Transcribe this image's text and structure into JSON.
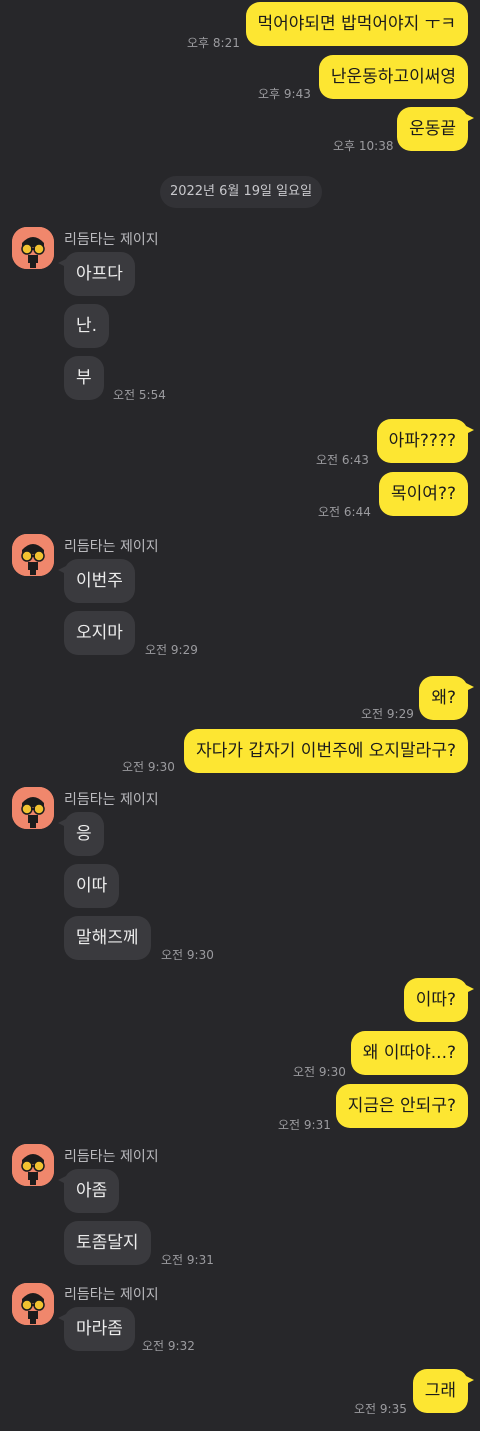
{
  "date_divider": "2022년 6월 19일 일요일",
  "sender_name": "리듬타는 제이지",
  "messages": {
    "m1": {
      "text": "먹어야되면 밥먹어야지 ㅜㅋ",
      "time": "오후 8:21"
    },
    "m2": {
      "text": "난운동하고이써영",
      "time": "오후 9:43"
    },
    "m3": {
      "text": "운동끝",
      "time": "오후 10:38"
    },
    "t1": {
      "text": "아프다"
    },
    "t2": {
      "text": "난."
    },
    "t3": {
      "text": "부",
      "time": "오전 5:54"
    },
    "m4": {
      "text": "아파????",
      "time": "오전 6:43"
    },
    "m5": {
      "text": "목이여??",
      "time": "오전 6:44"
    },
    "t4": {
      "text": "이번주"
    },
    "t5": {
      "text": "오지마",
      "time": "오전 9:29"
    },
    "m6": {
      "text": "왜?",
      "time": "오전 9:29"
    },
    "m7": {
      "text": "자다가 갑자기 이번주에 오지말라구?",
      "time": "오전 9:30"
    },
    "t6": {
      "text": "응"
    },
    "t7": {
      "text": "이따"
    },
    "t8": {
      "text": "말해즈께",
      "time": "오전 9:30"
    },
    "m8": {
      "text": "이따?"
    },
    "m9": {
      "text": "왜 이따야...?",
      "time": "오전 9:30"
    },
    "m10": {
      "text": "지금은 안되구?",
      "time": "오전 9:31"
    },
    "t9": {
      "text": "아좀"
    },
    "t10": {
      "text": "토좀달지",
      "time": "오전 9:31"
    },
    "t11": {
      "text": "마라좀",
      "time": "오전 9:32"
    },
    "m11": {
      "text": "그래",
      "time": "오전 9:35"
    }
  },
  "colors": {
    "background": "#27272a",
    "my_bubble": "#fde632",
    "their_bubble": "#3a3a3e",
    "avatar_bg": "#f0876c"
  }
}
